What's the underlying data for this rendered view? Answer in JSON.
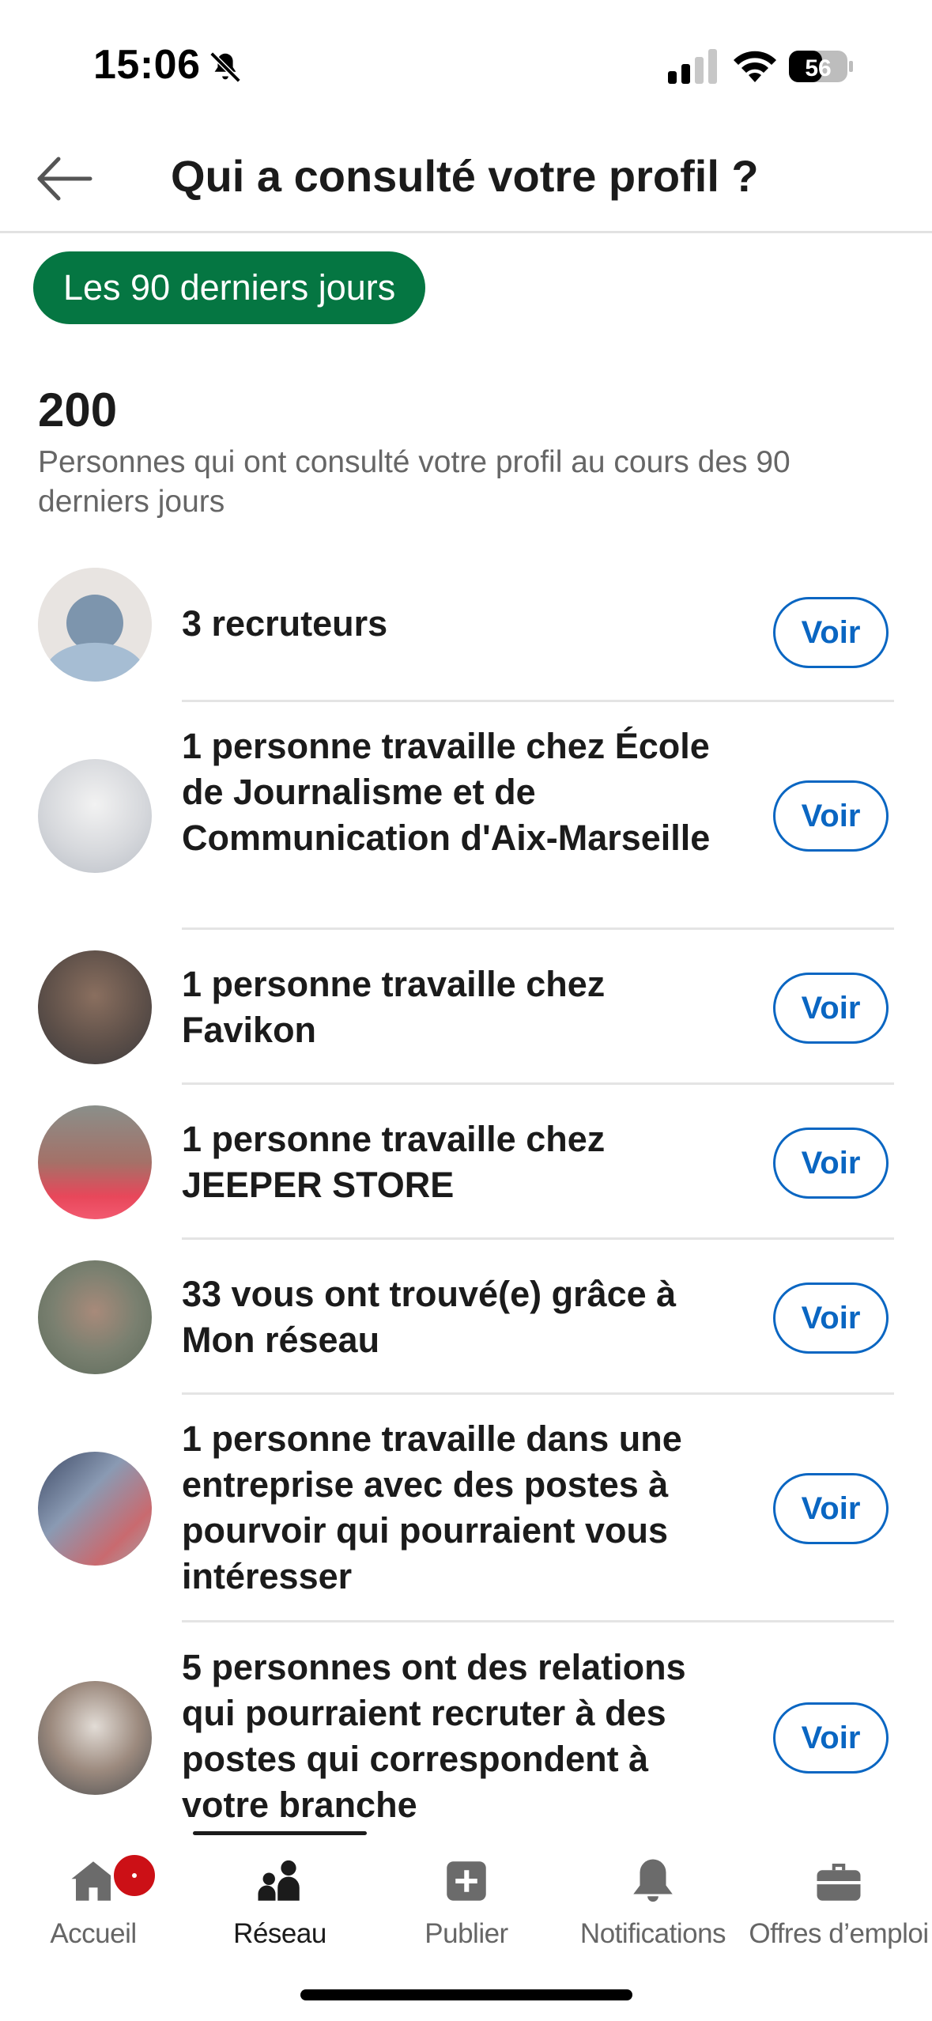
{
  "status": {
    "time": "15:06",
    "battery": "56"
  },
  "header": {
    "title": "Qui a consulté votre profil ?"
  },
  "filter": {
    "label": "Les 90 derniers jours"
  },
  "summary": {
    "count": "200",
    "description": "Personnes qui ont consulté votre profil au cours des 90 derniers jours"
  },
  "rows": [
    {
      "text": "3 recruteurs",
      "button": "Voir"
    },
    {
      "text": "1 personne travaille chez École de Journalisme et de Communication d'Aix-Marseille",
      "button": "Voir"
    },
    {
      "text": "1 personne travaille chez Favikon",
      "button": "Voir"
    },
    {
      "text": "1 personne travaille chez JEEPER STORE",
      "button": "Voir"
    },
    {
      "text": "33 vous ont trouvé(e) grâce à Mon réseau",
      "button": "Voir"
    },
    {
      "text": "1 personne travaille dans une entreprise avec des postes à pourvoir qui pourraient vous intéresser",
      "button": "Voir"
    },
    {
      "text": "5 personnes ont des relations qui pourraient recruter à des postes qui correspondent à votre branche",
      "button": "Voir"
    }
  ],
  "nav": {
    "items": [
      {
        "label": "Accueil",
        "icon": "home-icon"
      },
      {
        "label": "Réseau",
        "icon": "network-icon"
      },
      {
        "label": "Publier",
        "icon": "plus-icon"
      },
      {
        "label": "Notifications",
        "icon": "bell-icon"
      },
      {
        "label": "Offres d’emploi",
        "icon": "briefcase-icon"
      }
    ],
    "active": "Réseau"
  },
  "colors": {
    "accent": "#0a66c2",
    "pill": "#057642",
    "badge": "#cc1016"
  }
}
